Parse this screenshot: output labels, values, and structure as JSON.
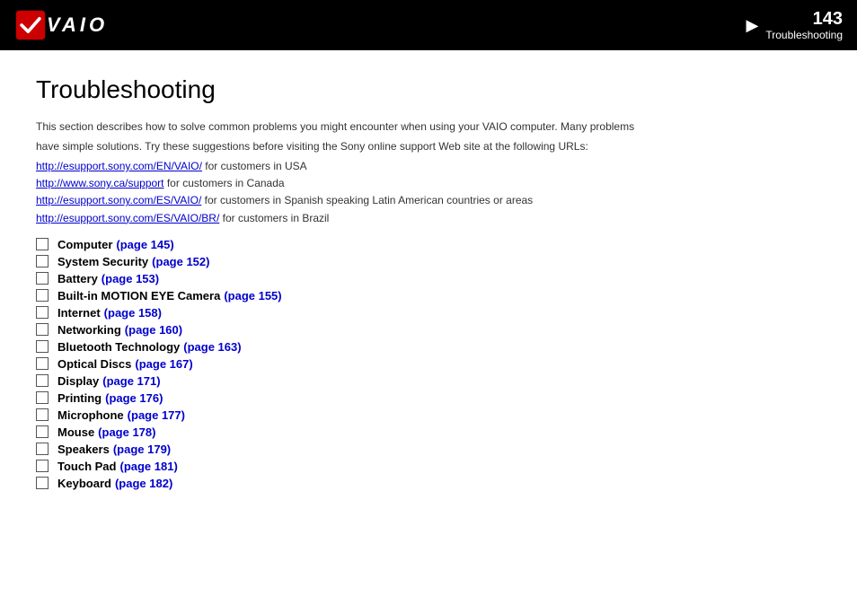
{
  "header": {
    "page_number": "143",
    "section": "Troubleshooting",
    "arrow": "▶"
  },
  "page_title": "Troubleshooting",
  "intro": {
    "line1": "This section describes how to solve common problems you might encounter when using your VAIO computer. Many problems",
    "line2": "have simple solutions. Try these suggestions before visiting the Sony online support Web site at the following URLs:"
  },
  "links": [
    {
      "url": "http://esupport.sony.com/EN/VAIO/",
      "suffix": " for customers in USA"
    },
    {
      "url": "http://www.sony.ca/support",
      "suffix": " for customers in Canada"
    },
    {
      "url": "http://esupport.sony.com/ES/VAIO/",
      "suffix": " for customers in Spanish speaking Latin American countries or areas"
    },
    {
      "url": "http://esupport.sony.com/ES/VAIO/BR/",
      "suffix": " for customers in Brazil"
    }
  ],
  "items": [
    {
      "label": "Computer",
      "pageref": "(page 145)"
    },
    {
      "label": "System Security",
      "pageref": "(page 152)"
    },
    {
      "label": "Battery",
      "pageref": "(page 153)"
    },
    {
      "label": "Built-in MOTION EYE Camera",
      "pageref": "(page 155)"
    },
    {
      "label": "Internet",
      "pageref": "(page 158)"
    },
    {
      "label": "Networking",
      "pageref": "(page 160)"
    },
    {
      "label": "Bluetooth Technology",
      "pageref": "(page 163)"
    },
    {
      "label": "Optical Discs",
      "pageref": "(page 167)"
    },
    {
      "label": "Display",
      "pageref": "(page 171)"
    },
    {
      "label": "Printing",
      "pageref": "(page 176)"
    },
    {
      "label": "Microphone",
      "pageref": "(page 177)"
    },
    {
      "label": "Mouse",
      "pageref": "(page 178)"
    },
    {
      "label": "Speakers",
      "pageref": "(page 179)"
    },
    {
      "label": "Touch Pad",
      "pageref": "(page 181)"
    },
    {
      "label": "Keyboard",
      "pageref": "(page 182)"
    }
  ]
}
